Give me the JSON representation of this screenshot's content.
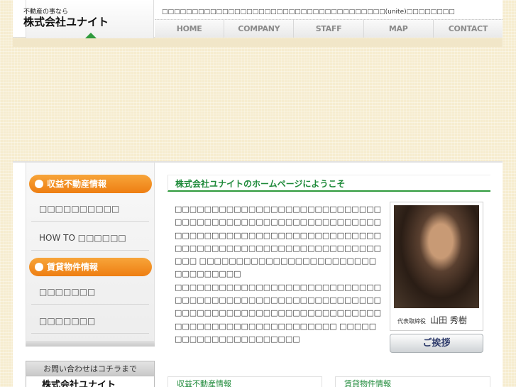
{
  "header": {
    "logo_sub": "不動産の事なら",
    "logo_main": "株式会社ユナイト",
    "tagline": "□□□□□□□□□□□□□□□□□□□□□□□□□□□□□□□□□□□□□(unite)□□□□□□□□"
  },
  "nav": {
    "items": [
      "HOME",
      "COMPANY",
      "STAFF",
      "MAP",
      "CONTACT"
    ]
  },
  "sidebar": {
    "section1_title": "収益不動産情報",
    "section1_links": [
      "□□□□□□□□□□",
      "HOW TO □□□□□□"
    ],
    "section2_title": "賃貸物件情報",
    "section2_links": [
      "□□□□□□□",
      "□□□□□□□"
    ],
    "contact_title": "お問い合わせはコチラまで",
    "contact_name": "株式会社ユナイト"
  },
  "welcome": {
    "title": "株式会社ユナイトのホームページにようこそ",
    "paragraph1": "□□□□□□□□□□□□□□□□□□□□□□□□□□□□□□□□□□□□□□□□□□□□□□□□□□□□□□□□□□□□□□□□□□□□□□□□□□□□□□□□□□□□□□□□□□□□□□□□□□□□□□□□□□□□□□□□□□□ □□□□□□□□□□□□□□□□□□□□□□□□□□□□□□□□□",
    "paragraph2": "□□□□□□□□□□□□□□□□□□□□□□□□□□□□□□□□□□□□□□□□□□□□□□□□□□□□□□□□□□□□□□□□□□□□□□□□□□□□□□□□□□□□□□□□□□□□□□□□□□□□□□□□□□ □□□□□□□□□□□□□□□□□□□□□□",
    "caption_role": "代表取締役",
    "caption_name": "山田 秀樹",
    "greeting_button": "ご挨拶"
  },
  "bottom_tabs": [
    "収益不動産情報",
    "賃貸物件情報"
  ]
}
